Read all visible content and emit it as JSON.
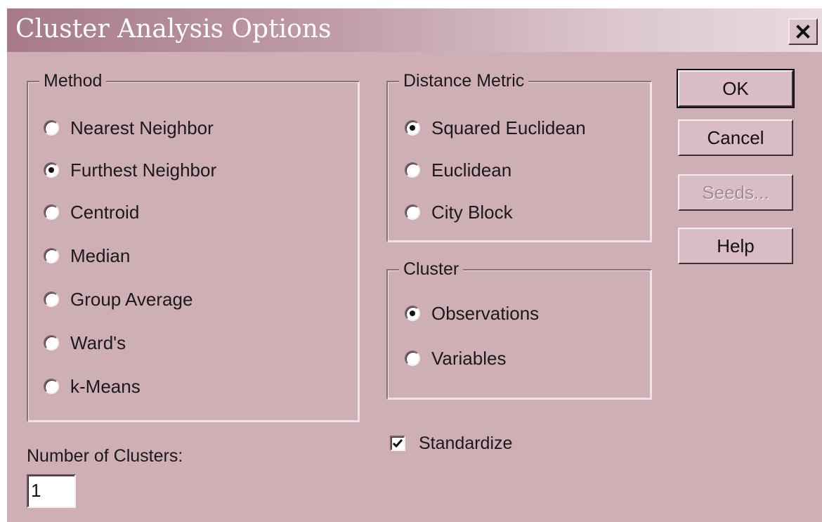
{
  "window": {
    "title": "Cluster Analysis Options"
  },
  "method": {
    "label": "Method",
    "options": [
      {
        "label": "Nearest Neighbor",
        "selected": false
      },
      {
        "label": "Furthest Neighbor",
        "selected": true
      },
      {
        "label": "Centroid",
        "selected": false
      },
      {
        "label": "Median",
        "selected": false
      },
      {
        "label": "Group Average",
        "selected": false
      },
      {
        "label": "Ward's",
        "selected": false
      },
      {
        "label": "k-Means",
        "selected": false
      }
    ]
  },
  "distance_metric": {
    "label": "Distance Metric",
    "options": [
      {
        "label": "Squared Euclidean",
        "selected": true
      },
      {
        "label": "Euclidean",
        "selected": false
      },
      {
        "label": "City Block",
        "selected": false
      }
    ]
  },
  "cluster": {
    "label": "Cluster",
    "options": [
      {
        "label": "Observations",
        "selected": true
      },
      {
        "label": "Variables",
        "selected": false
      }
    ]
  },
  "standardize": {
    "label": "Standardize",
    "checked": true
  },
  "number_of_clusters": {
    "label": "Number of Clusters:",
    "value": "1"
  },
  "buttons": {
    "ok": "OK",
    "cancel": "Cancel",
    "seeds": "Seeds...",
    "help": "Help"
  },
  "colors": {
    "dialog_bg": "#cfafb6",
    "titlebar_start": "#a77b89",
    "titlebar_end": "#e8dbe1"
  }
}
